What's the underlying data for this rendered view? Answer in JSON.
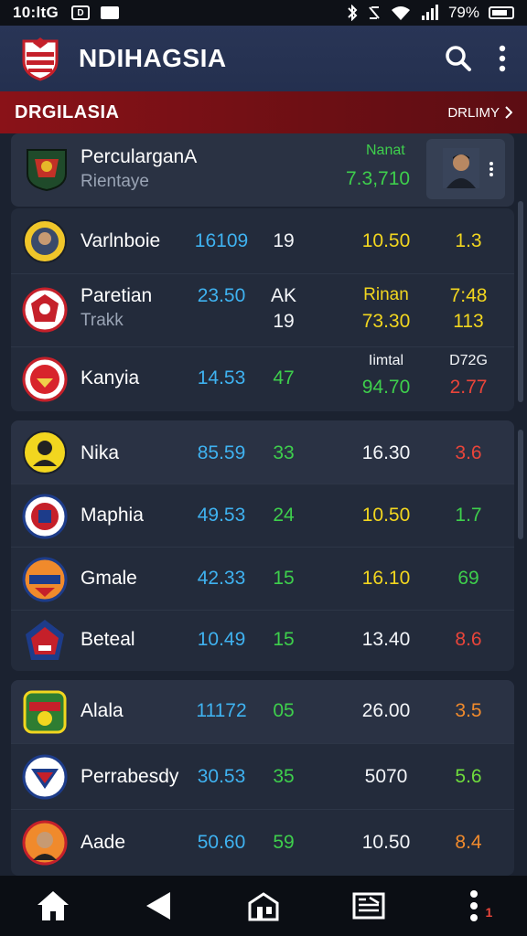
{
  "status": {
    "time": "10:ltG",
    "badge": "D",
    "badge2": "",
    "battery": "79%"
  },
  "header": {
    "title": "NDIHAGSIA"
  },
  "section": {
    "title": "DRGILASIA",
    "more": "DRLIMY"
  },
  "featured": {
    "name": "PercularganA",
    "sub": "Rientaye",
    "value_label": "Nanat",
    "value": "7.3,710"
  },
  "group1": [
    {
      "name": "Varlnboie",
      "c1": "16109",
      "c2": "19",
      "c3": "10.50",
      "c4": "1.3"
    },
    {
      "name": "Paretian",
      "sub": "Trakk",
      "c1": "23.50",
      "c2a": "AK",
      "c2b": "19",
      "c3a": "Rinan",
      "c3b": "73.30",
      "c4a": "7:48",
      "c4b": "113"
    },
    {
      "name": "Kanyia",
      "c1": "14.53",
      "c2": "47",
      "c3a": "Iimtal",
      "c3b": "94.70",
      "c4a": "D72G",
      "c4b": "2.77"
    }
  ],
  "group2": [
    {
      "name": "Nika",
      "c1": "85.59",
      "c2": "33",
      "c3": "16.30",
      "c4": "3.6"
    },
    {
      "name": "Maphia",
      "c1": "49.53",
      "c2": "24",
      "c3": "10.50",
      "c4": "1.7"
    },
    {
      "name": "Gmale",
      "c1": "42.33",
      "c2": "15",
      "c3": "16.10",
      "c4": "69"
    },
    {
      "name": "Beteal",
      "c1": "10.49",
      "c2": "15",
      "c3": "13.40",
      "c4": "8.6"
    }
  ],
  "group3": [
    {
      "name": "Alala",
      "c1": "11172",
      "c2": "05",
      "c3": "26.00",
      "c4": "3.5"
    },
    {
      "name": "Perrabesdy",
      "c1": "30.53",
      "c2": "35",
      "c3": "5070",
      "c4": "5.6"
    },
    {
      "name": "Aade",
      "c1": "50.60",
      "c2": "59",
      "c3": "10.50",
      "c4": "8.4"
    }
  ],
  "nav": {
    "badge": "1"
  },
  "colors": {
    "appbar": "#293556",
    "section": "#8a1218",
    "background": "#1b2230"
  }
}
